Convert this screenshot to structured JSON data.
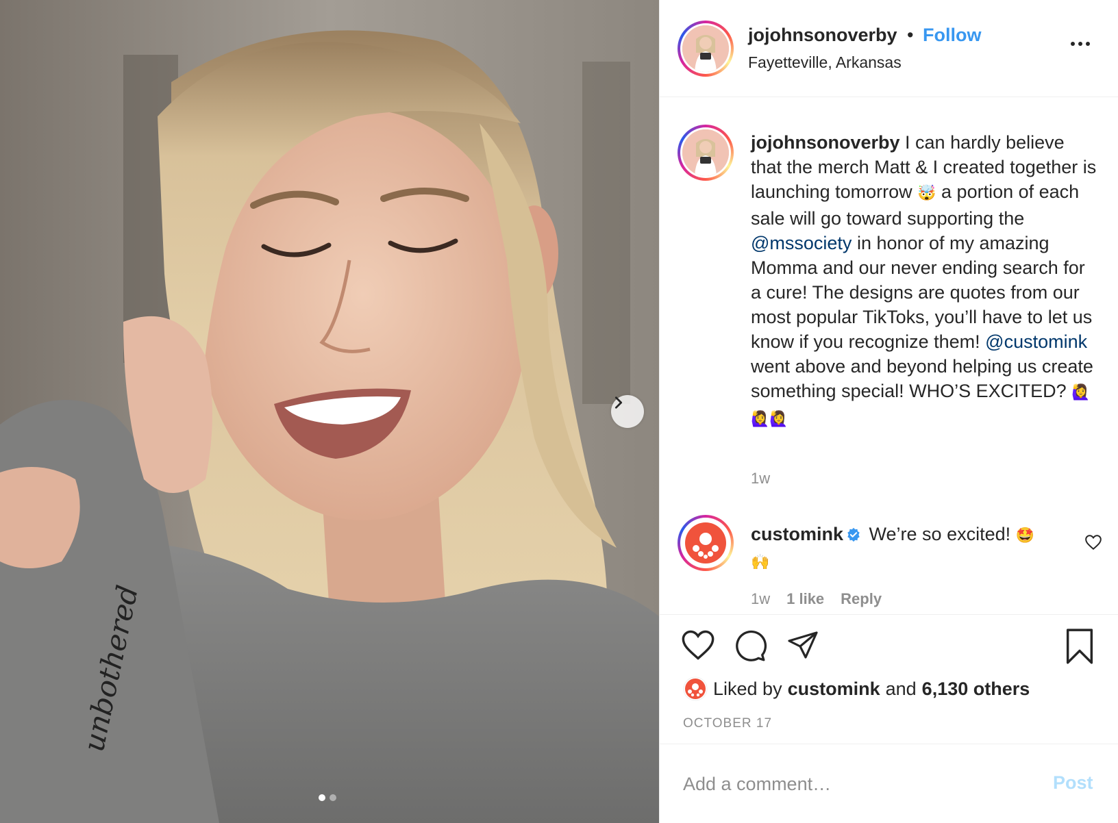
{
  "post": {
    "username": "jojohnsonoverby",
    "follow_label": "Follow",
    "separator": "•",
    "location": "Fayetteville, Arkansas",
    "image_sleeve_text": "unbothered"
  },
  "caption": {
    "username": "jojohnsonoverby",
    "text_part1": " I can hardly believe that the merch Matt & I created together is launching tomorrow ",
    "emoji1": "🤯",
    "text_part2": " a portion of each sale will go toward supporting the ",
    "mention1": "@mssociety",
    "text_part3": " in honor of my amazing Momma and our never ending search for a cure! The designs are quotes from our most popular TikToks, you’ll have to let us know if you recognize them! ",
    "mention2": "@customink",
    "text_part4": " went above and beyond helping us create something special! WHO’S EXCITED? ",
    "emoji2": "🙋‍♀️🙋‍♀️🙋‍♀️",
    "time": "1w"
  },
  "comment": {
    "username": "customink",
    "text": " We’re so excited! ",
    "emoji": "🤩 🙌",
    "time": "1w",
    "likes": "1 like",
    "reply_label": "Reply"
  },
  "likes": {
    "prefix": "Liked by",
    "user": "customink",
    "middle": "and",
    "others": "6,130 others"
  },
  "date": "OCTOBER 17",
  "add_comment": {
    "placeholder": "Add a comment…",
    "post_label": "Post"
  },
  "colors": {
    "link_blue": "#3897f0",
    "mention_blue": "#00376b",
    "muted": "#8e8e8e",
    "post_disabled": "#b2dffc",
    "customink_red": "#f0533c"
  },
  "icons": {
    "more": "more-options-icon",
    "next": "chevron-right-icon",
    "like": "heart-icon",
    "comment": "comment-icon",
    "share": "paper-plane-icon",
    "save": "bookmark-icon",
    "verified": "verified-badge-icon"
  }
}
